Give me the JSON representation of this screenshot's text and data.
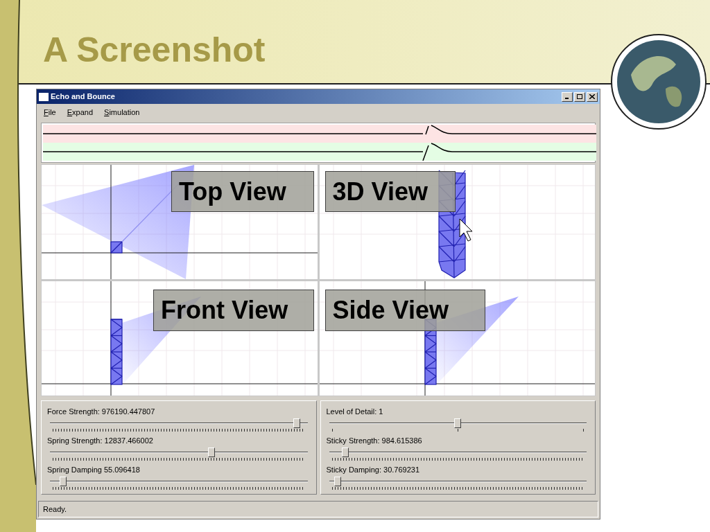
{
  "slide": {
    "title": "A Screenshot"
  },
  "window": {
    "title": "Echo and Bounce"
  },
  "menu": [
    {
      "label": "File"
    },
    {
      "label": "Expand"
    },
    {
      "label": "Simulation"
    }
  ],
  "views": [
    {
      "kind": "top",
      "label": "Top View"
    },
    {
      "kind": "perspective",
      "label": "3D View"
    },
    {
      "kind": "front",
      "label": "Front View"
    },
    {
      "kind": "side",
      "label": "Side View"
    }
  ],
  "slider_groups": [
    {
      "sliders": [
        {
          "label": "Force Strength: 976190.447807",
          "level": 0.97,
          "kind": "fine"
        },
        {
          "label": "Spring Strength: 12837.466002",
          "level": 0.63,
          "kind": "fine"
        },
        {
          "label": "Spring Damping 55.096418",
          "level": 0.04,
          "kind": "fine"
        }
      ]
    },
    {
      "sliders": [
        {
          "label": "Level of Detail: 1",
          "level": 0.5,
          "kind": "coarse"
        },
        {
          "label": "Sticky Strength: 984.615386",
          "level": 0.05,
          "kind": "fine"
        },
        {
          "label": "Sticky Damping: 30.769231",
          "level": 0.02,
          "kind": "fine"
        }
      ]
    }
  ],
  "status_bar": "Ready."
}
